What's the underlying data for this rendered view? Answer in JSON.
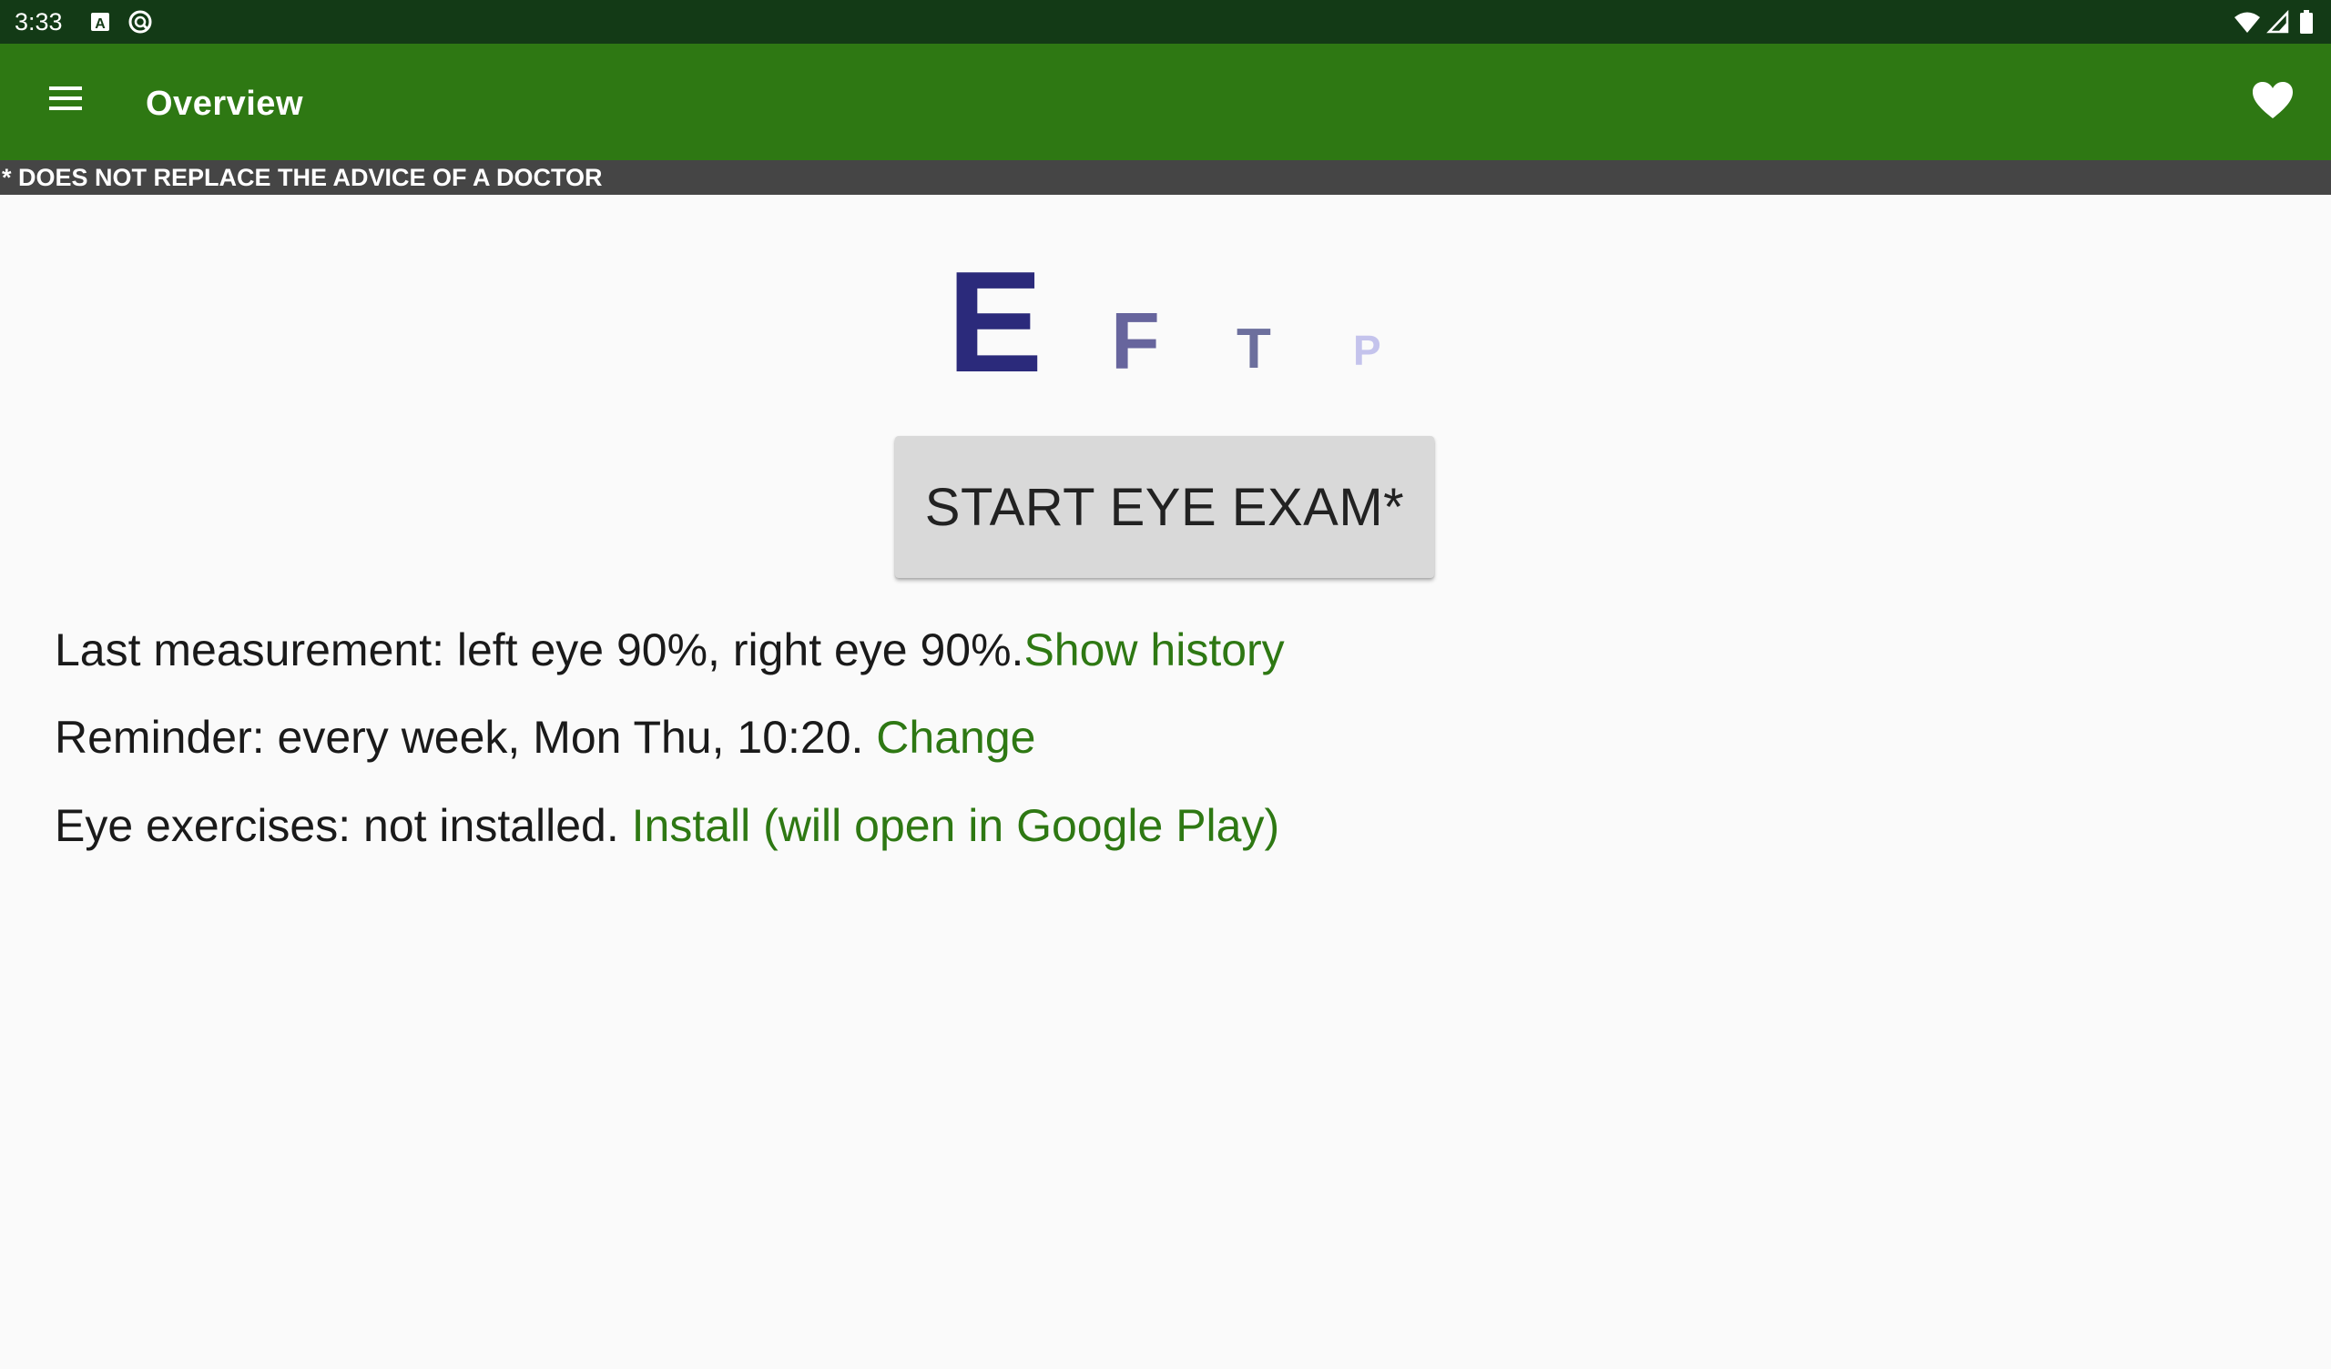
{
  "status_bar": {
    "time": "3:33",
    "icons_left": [
      "a-box-icon",
      "sync-circle-icon"
    ],
    "icons_right": [
      "wifi-icon",
      "cell-signal-icon",
      "battery-icon"
    ]
  },
  "app_bar": {
    "title": "Overview",
    "menu_icon": "hamburger-menu-icon",
    "action_icon": "heart-icon",
    "color": "#2e7813"
  },
  "disclaimer": "* DOES NOT REPLACE THE ADVICE OF A DOCTOR",
  "eye_chart": {
    "letters": [
      "E",
      "F",
      "T",
      "P"
    ],
    "colors": [
      "#2b2a7b",
      "#67659d",
      "#6c6f9d",
      "#c4c3ec"
    ]
  },
  "start_button": {
    "label": "START EYE EXAM*"
  },
  "info": {
    "measurement": {
      "text": "Last measurement: left eye 90%, right eye 90%.",
      "link": "Show history"
    },
    "reminder": {
      "text": "Reminder: every week, Mon Thu, 10:20.",
      "link": " Change"
    },
    "exercises": {
      "text": "Eye exercises: not installed. ",
      "link": "Install (will open in Google Play)"
    }
  },
  "colors": {
    "status_bar": "#133a16",
    "link": "#2e7813",
    "disclaimer_bg": "#454545",
    "background": "#fafafa"
  }
}
